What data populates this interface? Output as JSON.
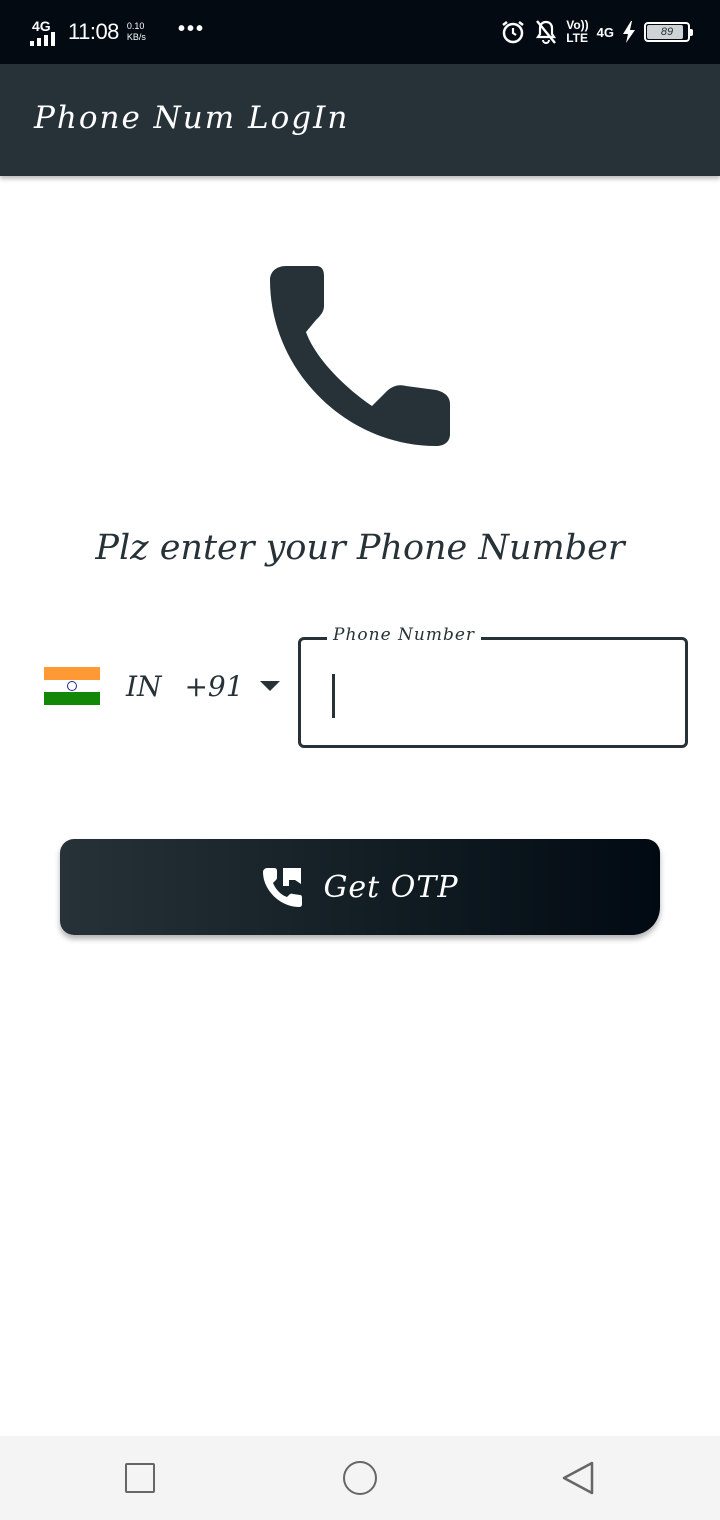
{
  "status_bar": {
    "network": "4G",
    "time": "11:08",
    "speed_value": "0.10",
    "speed_unit": "KB/s",
    "more": "•••",
    "volte_top": "Vo))",
    "volte_bottom": "LTE",
    "network_right": "4G",
    "battery_level": "89"
  },
  "app_bar": {
    "title": "Phone Num LogIn"
  },
  "main": {
    "prompt": "Plz enter your Phone Number",
    "country": {
      "iso": "IN",
      "dial_code": "+91",
      "flag_colors": [
        "#ff9933",
        "#ffffff",
        "#138808"
      ]
    },
    "phone_field": {
      "label": "Phone Number",
      "value": ""
    },
    "otp_button": {
      "label": "Get OTP"
    }
  },
  "colors": {
    "primary": "#263238",
    "status_bar": "#030a12",
    "nav_bar": "#f4f4f4"
  },
  "icons": {
    "hero": "phone-icon",
    "button": "phone-callback-icon",
    "nav": [
      "recents-icon",
      "home-icon",
      "back-icon"
    ]
  }
}
